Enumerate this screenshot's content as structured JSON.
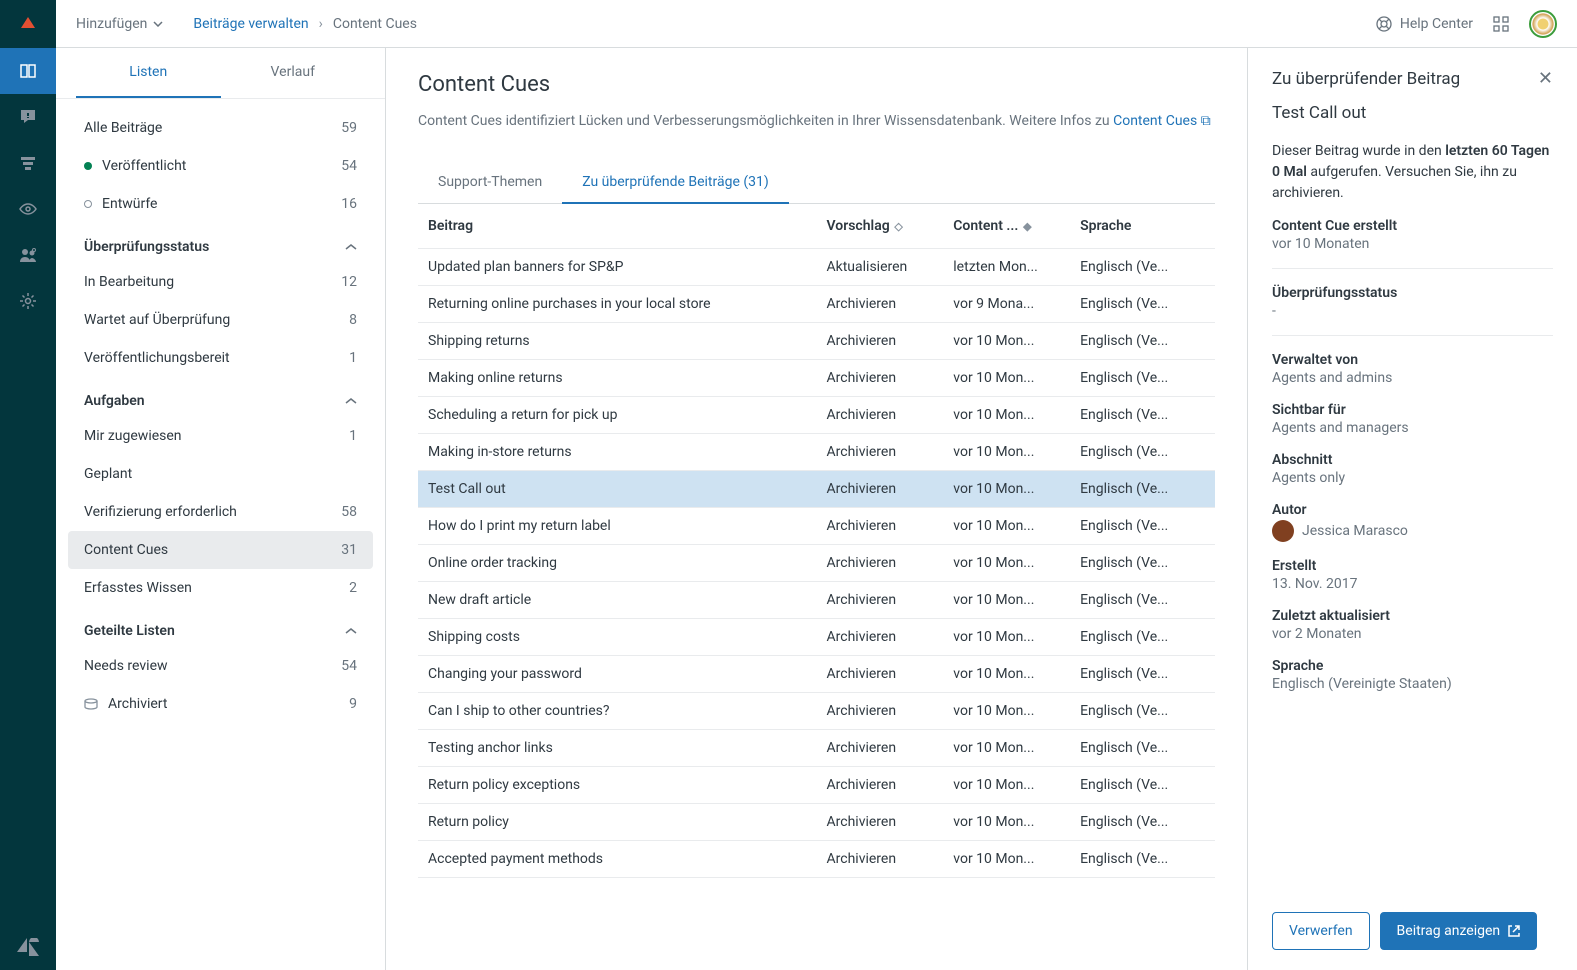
{
  "topbar": {
    "add": "Hinzufügen",
    "breadcrumb_link": "Beiträge verwalten",
    "breadcrumb_current": "Content Cues",
    "help": "Help Center"
  },
  "sidebar": {
    "tabs": {
      "listen": "Listen",
      "verlauf": "Verlauf"
    },
    "all": {
      "label": "Alle Beiträge",
      "count": "59"
    },
    "published": {
      "label": "Veröffentlicht",
      "count": "54"
    },
    "drafts": {
      "label": "Entwürfe",
      "count": "16"
    },
    "sec_review": "Überprüfungsstatus",
    "in_progress": {
      "label": "In Bearbeitung",
      "count": "12"
    },
    "awaiting": {
      "label": "Wartet auf Überprüfung",
      "count": "8"
    },
    "ready": {
      "label": "Veröffentlichungsbereit",
      "count": "1"
    },
    "sec_tasks": "Aufgaben",
    "assigned": {
      "label": "Mir zugewiesen",
      "count": "1"
    },
    "planned": {
      "label": "Geplant",
      "count": ""
    },
    "verify": {
      "label": "Verifizierung erforderlich",
      "count": "58"
    },
    "cues": {
      "label": "Content Cues",
      "count": "31"
    },
    "captured": {
      "label": "Erfasstes Wissen",
      "count": "2"
    },
    "sec_shared": "Geteilte Listen",
    "needs_review": {
      "label": "Needs review",
      "count": "54"
    },
    "archived": {
      "label": "Archiviert",
      "count": "9"
    }
  },
  "center": {
    "title": "Content Cues",
    "desc1": "Content Cues identifiziert Lücken und Verbesserungsmöglichkeiten in Ihrer Wissensdatenbank. Weitere Infos zu ",
    "desc_link": "Content Cues",
    "tab_support": "Support-Themen",
    "tab_review": "Zu überprüfende Beiträge (31)",
    "cols": {
      "beitrag": "Beitrag",
      "vorschlag": "Vorschlag",
      "cc": "Content ...",
      "sprache": "Sprache"
    },
    "lang": "Englisch (Ve...",
    "rows": [
      {
        "t": "Updated plan banners for SP&P",
        "v": "Aktualisieren",
        "c": "letzten Mon..."
      },
      {
        "t": "Returning online purchases in your local store",
        "v": "Archivieren",
        "c": "vor 9 Mona..."
      },
      {
        "t": "Shipping returns",
        "v": "Archivieren",
        "c": "vor 10 Mon..."
      },
      {
        "t": "Making online returns",
        "v": "Archivieren",
        "c": "vor 10 Mon..."
      },
      {
        "t": "Scheduling a return for pick up",
        "v": "Archivieren",
        "c": "vor 10 Mon..."
      },
      {
        "t": "Making in-store returns",
        "v": "Archivieren",
        "c": "vor 10 Mon..."
      },
      {
        "t": "Test Call out",
        "v": "Archivieren",
        "c": "vor 10 Mon...",
        "sel": true
      },
      {
        "t": "How do I print my return label",
        "v": "Archivieren",
        "c": "vor 10 Mon..."
      },
      {
        "t": "Online order tracking",
        "v": "Archivieren",
        "c": "vor 10 Mon..."
      },
      {
        "t": "New draft article",
        "v": "Archivieren",
        "c": "vor 10 Mon..."
      },
      {
        "t": "Shipping costs",
        "v": "Archivieren",
        "c": "vor 10 Mon..."
      },
      {
        "t": "Changing your password",
        "v": "Archivieren",
        "c": "vor 10 Mon..."
      },
      {
        "t": "Can I ship to other countries?",
        "v": "Archivieren",
        "c": "vor 10 Mon..."
      },
      {
        "t": "Testing anchor links",
        "v": "Archivieren",
        "c": "vor 10 Mon..."
      },
      {
        "t": "Return policy exceptions",
        "v": "Archivieren",
        "c": "vor 10 Mon..."
      },
      {
        "t": "Return policy",
        "v": "Archivieren",
        "c": "vor 10 Mon..."
      },
      {
        "t": "Accepted payment methods",
        "v": "Archivieren",
        "c": "vor 10 Mon..."
      }
    ]
  },
  "panel": {
    "heading": "Zu überprüfender Beitrag",
    "title": "Test Call out",
    "msg_pre": "Dieser Beitrag wurde in den ",
    "msg_bold": "letzten 60 Tagen 0 Mal",
    "msg_post": " aufgerufen. Versuchen Sie, ihn zu archivieren.",
    "cc_label": "Content Cue erstellt",
    "cc_value": "vor 10 Monaten",
    "status_label": "Überprüfungsstatus",
    "status_value": "-",
    "managed_label": "Verwaltet von",
    "managed_value": "Agents and admins",
    "visible_label": "Sichtbar für",
    "visible_value": "Agents and managers",
    "section_label": "Abschnitt",
    "section_value": "Agents only",
    "author_label": "Autor",
    "author_value": "Jessica Marasco",
    "created_label": "Erstellt",
    "created_value": "13. Nov. 2017",
    "updated_label": "Zuletzt aktualisiert",
    "updated_value": "vor 2 Monaten",
    "lang_label": "Sprache",
    "lang_value": "Englisch (Vereinigte Staaten)",
    "discard": "Verwerfen",
    "show": "Beitrag anzeigen"
  }
}
